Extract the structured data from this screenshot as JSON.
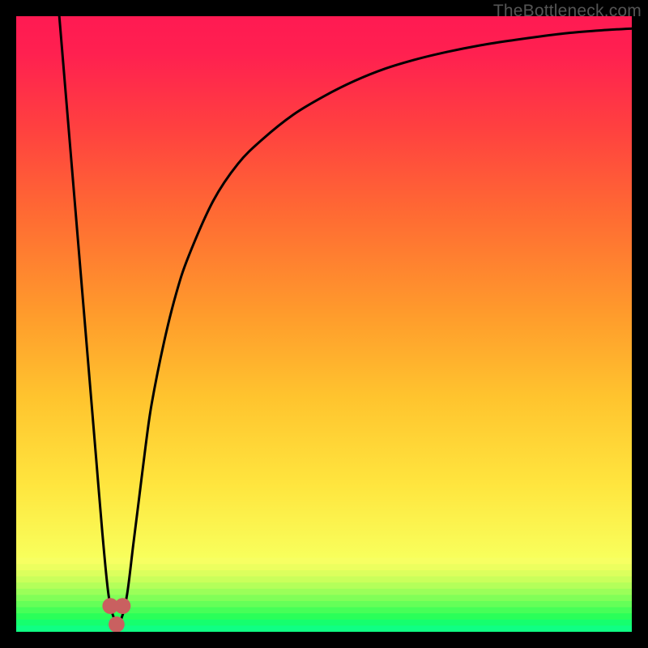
{
  "watermark": "TheBottleneck.com",
  "chart_data": {
    "type": "line",
    "title": "",
    "xlabel": "",
    "ylabel": "",
    "xlim": [
      0,
      100
    ],
    "ylim": [
      0,
      100
    ],
    "series": [
      {
        "name": "bottleneck-curve",
        "x": [
          7,
          8,
          9,
          10,
          11,
          12,
          13,
          14,
          15,
          16,
          17,
          18,
          19,
          20,
          21,
          22,
          24,
          26,
          28,
          32,
          36,
          40,
          45,
          50,
          55,
          60,
          65,
          70,
          75,
          80,
          85,
          90,
          95,
          100
        ],
        "values": [
          100,
          88,
          76,
          64,
          52,
          40,
          28,
          16,
          6,
          2,
          2,
          6,
          14,
          22,
          30,
          37,
          47,
          55,
          61,
          70,
          76,
          80,
          84,
          87,
          89.5,
          91.5,
          93,
          94.2,
          95.2,
          96,
          96.7,
          97.3,
          97.7,
          98
        ]
      }
    ],
    "markers": {
      "name": "highlight-cluster",
      "color": "#c96060",
      "points": [
        {
          "x": 15.3,
          "y": 4.2
        },
        {
          "x": 17.3,
          "y": 4.2
        },
        {
          "x": 16.3,
          "y": 1.2
        }
      ],
      "radius_pct": 1.3
    },
    "bottom_stripes": [
      {
        "y_top": 12.0,
        "color": "#f7ff62"
      },
      {
        "y_top": 11.0,
        "color": "#ecff5f"
      },
      {
        "y_top": 10.0,
        "color": "#dcff5d"
      },
      {
        "y_top": 9.0,
        "color": "#caff5b"
      },
      {
        "y_top": 8.0,
        "color": "#b4ff5a"
      },
      {
        "y_top": 7.0,
        "color": "#9bff59"
      },
      {
        "y_top": 6.0,
        "color": "#81ff58"
      },
      {
        "y_top": 5.0,
        "color": "#65ff58"
      },
      {
        "y_top": 4.0,
        "color": "#47ff58"
      },
      {
        "y_top": 3.0,
        "color": "#2aff59"
      },
      {
        "y_top": 2.0,
        "color": "#16ff6e"
      },
      {
        "y_top": 1.0,
        "color": "#10ff84"
      }
    ]
  }
}
